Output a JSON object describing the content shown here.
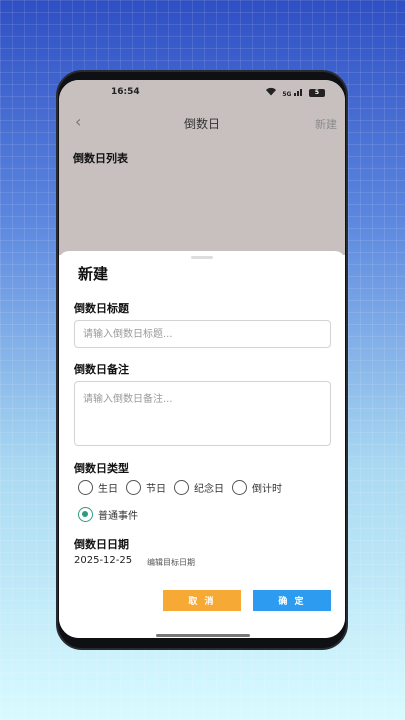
{
  "status_bar": {
    "time": "16:54",
    "signal_label": "5G",
    "battery": "5"
  },
  "nav": {
    "back_icon": "chevron-left-icon",
    "title": "倒数日",
    "new_label": "新建"
  },
  "list": {
    "title": "倒数日列表"
  },
  "sheet": {
    "title": "新建",
    "title_label": "倒数日标题",
    "title_placeholder": "请输入倒数日标题...",
    "note_label": "倒数日备注",
    "note_placeholder": "请输入倒数日备注...",
    "type_label": "倒数日类型",
    "types": [
      "生日",
      "节日",
      "纪念日",
      "倒计时",
      "普通事件"
    ],
    "selected_type": "普通事件",
    "date_label": "倒数日日期",
    "date_value": "2025-12-25",
    "edit_date_label": "编辑目标日期",
    "cancel_label": "取 消",
    "ok_label": "确 定"
  },
  "colors": {
    "accent_green": "#2e9b7f",
    "cancel": "#f6a935",
    "confirm": "#2d9bf0"
  }
}
